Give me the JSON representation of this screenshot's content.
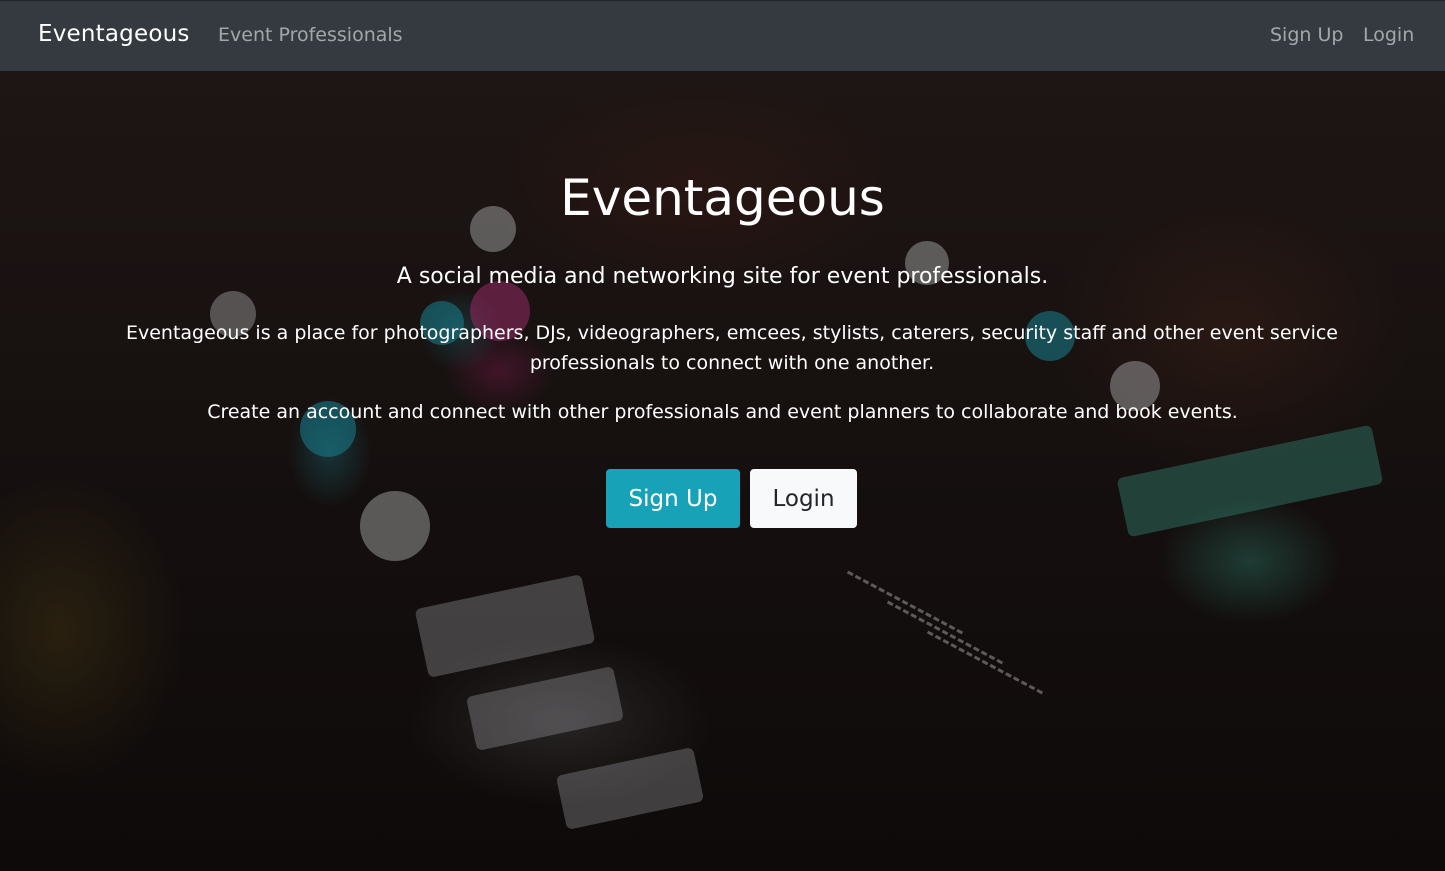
{
  "navbar": {
    "brand": "Eventageous",
    "links": {
      "professionals": "Event Professionals",
      "signup": "Sign Up",
      "login": "Login"
    },
    "background": "#343a40"
  },
  "hero": {
    "title": "Eventageous",
    "lead": "A social media and networking site for event professionals.",
    "description": "Eventageous is a place for photographers, DJs, videographers, emcees, stylists, caterers, security staff and other event service professionals to connect with one another.",
    "call_to_action": "Create an account and connect with other professionals and event planners to collaborate and book events.",
    "buttons": {
      "signup": "Sign Up",
      "login": "Login"
    },
    "colors": {
      "signup_button": "#17a2b8",
      "login_button": "#f8f9fa"
    }
  }
}
